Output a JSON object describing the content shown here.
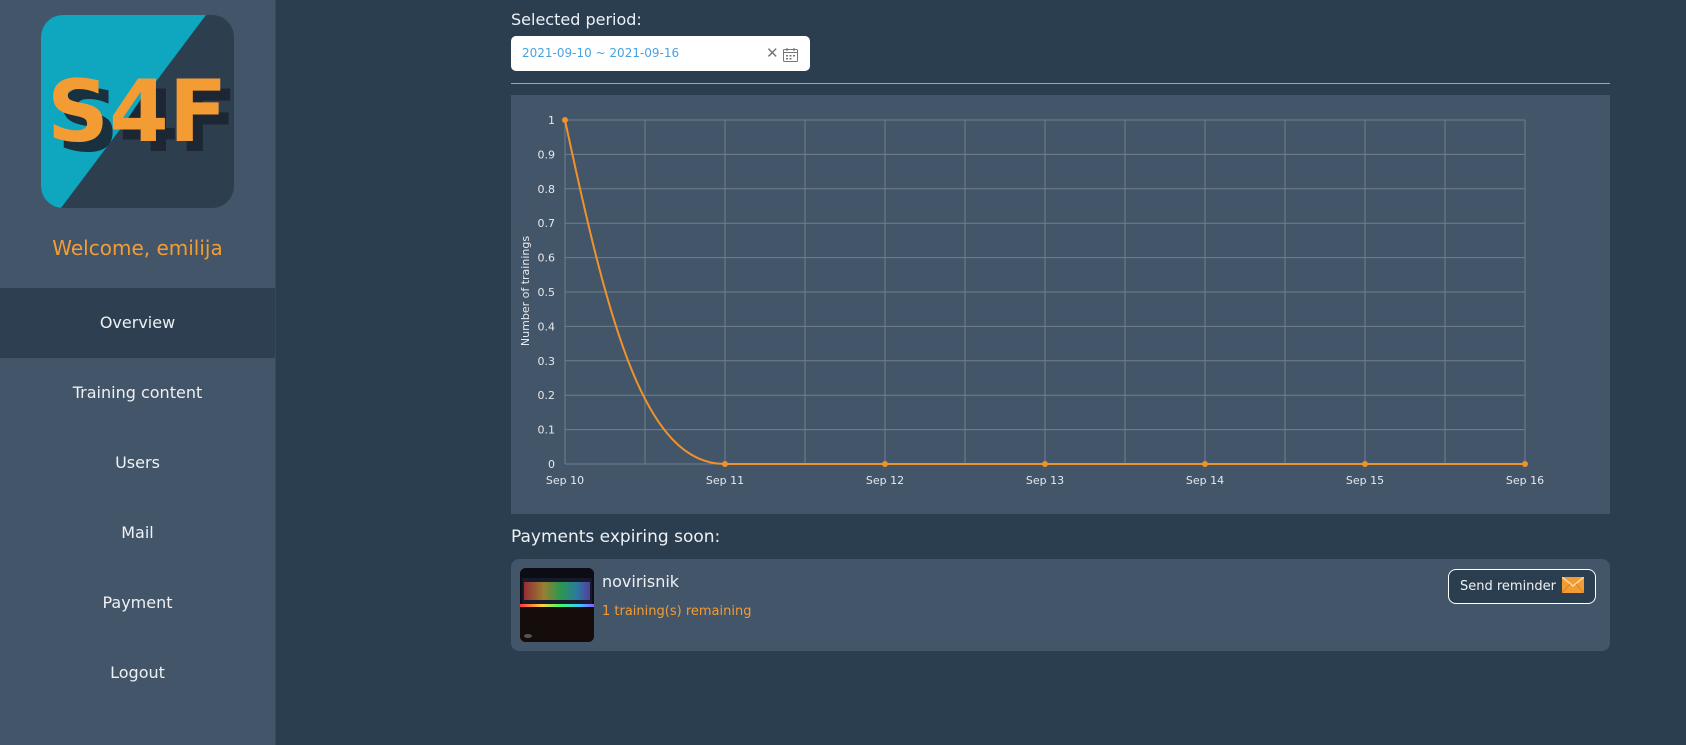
{
  "sidebar": {
    "logo_text": "S4F",
    "welcome": "Welcome, emilija",
    "items": [
      {
        "label": "Overview",
        "active": true
      },
      {
        "label": "Training content"
      },
      {
        "label": "Users"
      },
      {
        "label": "Mail"
      },
      {
        "label": "Payment"
      },
      {
        "label": "Logout"
      }
    ]
  },
  "period": {
    "label": "Selected period:",
    "value": "2021-09-10 ~ 2021-09-16",
    "clear_icon": "close-icon",
    "calendar_icon": "calendar-icon"
  },
  "chart_data": {
    "type": "line",
    "ylabel": "Number of trainings",
    "xlabel": "",
    "categories": [
      "Sep 10",
      "Sep 11",
      "Sep 12",
      "Sep 13",
      "Sep 14",
      "Sep 15",
      "Sep 16"
    ],
    "series": [
      {
        "values": [
          1,
          0,
          0,
          0,
          0,
          0,
          0
        ],
        "color": "#f0922b"
      }
    ],
    "ylim": [
      0,
      1
    ],
    "yticks": [
      "0",
      "0.1",
      "0.2",
      "0.3",
      "0.4",
      "0.5",
      "0.6",
      "0.7",
      "0.8",
      "0.9",
      "1"
    ],
    "grid": true,
    "legend": "none"
  },
  "payments": {
    "label": "Payments expiring soon:",
    "items": [
      {
        "name": "novirisnik",
        "remaining": "1 training(s) remaining",
        "button": "Send reminder",
        "button_icon": "envelope-icon"
      }
    ]
  },
  "colors": {
    "accent": "#f39c34",
    "background": "#2b3e50",
    "panel": "#435569"
  }
}
